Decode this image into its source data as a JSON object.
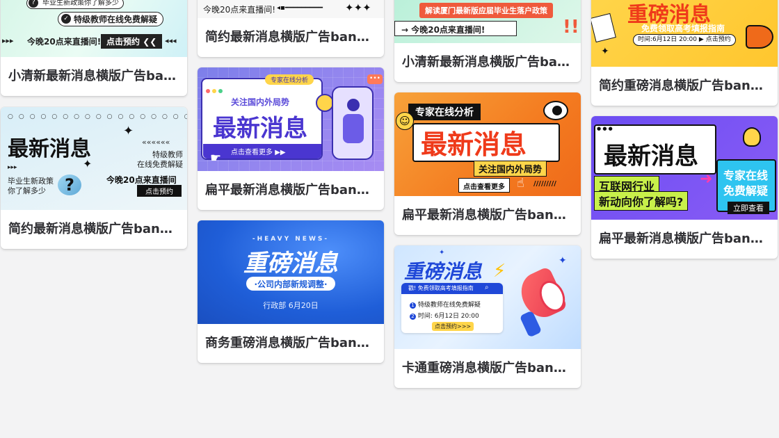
{
  "cards": [
    {
      "caption": "小清新最新消息横版广告banner",
      "thumb": {
        "line1": "毕业生新政策你了解多少",
        "line2": "特级教师在线免费解疑",
        "line3": "今晚20点来直播间!",
        "button": "点击预约"
      }
    },
    {
      "caption": "简约最新消息横版广告banner",
      "thumb": {
        "title": "最新消息",
        "sub1": "特级教师",
        "sub2": "在线免费解疑",
        "left1": "毕业生新政策",
        "left2": "你了解多少",
        "time": "今晚20点来直播间",
        "button": "点击预约"
      }
    },
    {
      "caption": "简约最新消息横版广告banner",
      "thumb": {
        "line": "今晚20点来直播间!"
      }
    },
    {
      "caption": "扁平最新消息横版广告banner",
      "thumb": {
        "tag": "专家在线分析",
        "sub": "关注国内外局势",
        "title": "最新消息",
        "button": "点击查看更多"
      }
    },
    {
      "caption": "商务重磅消息横版广告banner",
      "thumb": {
        "eyebrow": "-HEAVY NEWS-",
        "title": "重磅消息",
        "pill": "·公司内部新规调整·",
        "footer": "行政部 6月20日"
      }
    },
    {
      "caption": "小清新最新消息横版广告banner",
      "thumb": {
        "banner": "解读厦门最新版应届毕业生落户政策",
        "line": "今晚20点来直播间!"
      }
    },
    {
      "caption": "扁平最新消息横版广告banner",
      "thumb": {
        "tag": "专家在线分析",
        "title": "最新消息",
        "sub": "关注国内外局势",
        "button": "点击查看更多"
      }
    },
    {
      "caption": "卡通重磅消息横版广告banner",
      "thumb": {
        "title": "重磅消息",
        "line0": "戳! 免费领取高考填报指南",
        "line1": "特级教师在线免费解疑",
        "line2": "时间: 6月12日 20:00",
        "button": "点击预约>>>"
      }
    },
    {
      "caption": "简约重磅消息横版广告banner",
      "thumb": {
        "title": "重磅消息",
        "sub": "免费领取高考填报指南",
        "time": "时间:6月12日 20:00",
        "button": "点击预约"
      }
    },
    {
      "caption": "扁平最新消息横版广告banner",
      "thumb": {
        "title": "最新消息",
        "line1": "互联网行业",
        "line2": "新动向你了解吗?",
        "side1": "专家在线",
        "side2": "免费解疑",
        "button": "立即查看"
      }
    }
  ],
  "colors": {
    "background": "#f3f3f4",
    "caption_text": "#2f2f33",
    "orange": "#f47b20",
    "blue": "#2d6ef0",
    "purple": "#5b4bd9",
    "mint": "#c9f3e6"
  }
}
